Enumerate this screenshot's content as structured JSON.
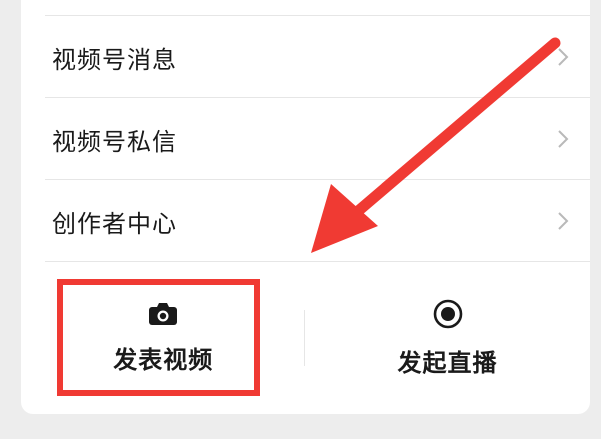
{
  "menu": {
    "items": [
      {
        "label": "视频号消息"
      },
      {
        "label": "视频号私信"
      },
      {
        "label": "创作者中心"
      }
    ]
  },
  "actions": {
    "post_video": {
      "label": "发表视频",
      "icon": "camera-icon"
    },
    "go_live": {
      "label": "发起直播",
      "icon": "record-icon"
    }
  },
  "annotation": {
    "highlight_color": "#f03a33",
    "arrow_color": "#f03a33"
  }
}
